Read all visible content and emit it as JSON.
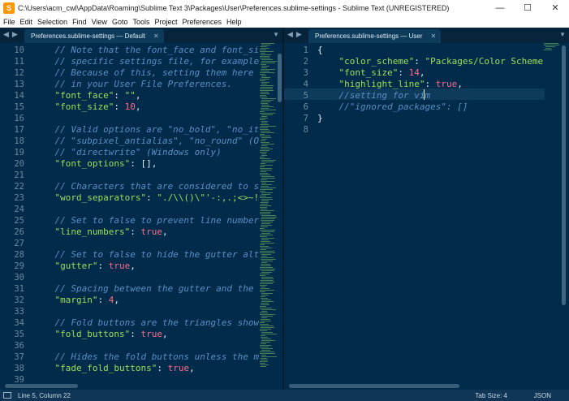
{
  "window": {
    "title": "C:\\Users\\acm_cwl\\AppData\\Roaming\\Sublime Text 3\\Packages\\User\\Preferences.sublime-settings - Sublime Text (UNREGISTERED)",
    "minimize": "—",
    "maximize": "☐",
    "close": "✕"
  },
  "menu": [
    "File",
    "Edit",
    "Selection",
    "Find",
    "View",
    "Goto",
    "Tools",
    "Project",
    "Preferences",
    "Help"
  ],
  "left_pane": {
    "tab_label": "Preferences.sublime-settings — Default",
    "line_numbers": [
      "10",
      "11",
      "12",
      "13",
      "14",
      "15",
      "16",
      "17",
      "18",
      "19",
      "20",
      "21",
      "22",
      "23",
      "24",
      "25",
      "26",
      "27",
      "28",
      "29",
      "30",
      "31",
      "32",
      "33",
      "34",
      "35",
      "36",
      "37",
      "38",
      "39"
    ],
    "lines": [
      [
        {
          "t": "    // Note that the font_face and font_si",
          "c": "comment"
        }
      ],
      [
        {
          "t": "    // specific settings file, for example,",
          "c": "comment"
        }
      ],
      [
        {
          "t": "    // Because of this, setting them here",
          "c": "comment"
        }
      ],
      [
        {
          "t": "    // in your User File Preferences.",
          "c": "comment"
        }
      ],
      [
        {
          "t": "    ",
          "c": "punc"
        },
        {
          "t": "\"font_face\"",
          "c": "key"
        },
        {
          "t": ": ",
          "c": "punc"
        },
        {
          "t": "\"\"",
          "c": "str"
        },
        {
          "t": ",",
          "c": "punc"
        }
      ],
      [
        {
          "t": "    ",
          "c": "punc"
        },
        {
          "t": "\"font_size\"",
          "c": "key"
        },
        {
          "t": ": ",
          "c": "punc"
        },
        {
          "t": "10",
          "c": "num"
        },
        {
          "t": ",",
          "c": "punc"
        }
      ],
      [
        {
          "t": "",
          "c": "punc"
        }
      ],
      [
        {
          "t": "    // Valid options are \"no_bold\", \"no_ita",
          "c": "comment"
        }
      ],
      [
        {
          "t": "    // \"subpixel_antialias\", \"no_round\" (OS",
          "c": "comment"
        }
      ],
      [
        {
          "t": "    // \"directwrite\" (Windows only)",
          "c": "comment"
        }
      ],
      [
        {
          "t": "    ",
          "c": "punc"
        },
        {
          "t": "\"font_options\"",
          "c": "key"
        },
        {
          "t": ": [],",
          "c": "punc"
        }
      ],
      [
        {
          "t": "",
          "c": "punc"
        }
      ],
      [
        {
          "t": "    // Characters that are considered to se",
          "c": "comment"
        }
      ],
      [
        {
          "t": "    ",
          "c": "punc"
        },
        {
          "t": "\"word_separators\"",
          "c": "key"
        },
        {
          "t": ": ",
          "c": "punc"
        },
        {
          "t": "\"./\\\\()\\\"'-:,.;<>~!@",
          "c": "str"
        }
      ],
      [
        {
          "t": "",
          "c": "punc"
        }
      ],
      [
        {
          "t": "    // Set to false to prevent line numbers",
          "c": "comment"
        }
      ],
      [
        {
          "t": "    ",
          "c": "punc"
        },
        {
          "t": "\"line_numbers\"",
          "c": "key"
        },
        {
          "t": ": ",
          "c": "punc"
        },
        {
          "t": "true",
          "c": "kw"
        },
        {
          "t": ",",
          "c": "punc"
        }
      ],
      [
        {
          "t": "",
          "c": "punc"
        }
      ],
      [
        {
          "t": "    // Set to false to hide the gutter alto",
          "c": "comment"
        }
      ],
      [
        {
          "t": "    ",
          "c": "punc"
        },
        {
          "t": "\"gutter\"",
          "c": "key"
        },
        {
          "t": ": ",
          "c": "punc"
        },
        {
          "t": "true",
          "c": "kw"
        },
        {
          "t": ",",
          "c": "punc"
        }
      ],
      [
        {
          "t": "",
          "c": "punc"
        }
      ],
      [
        {
          "t": "    // Spacing between the gutter and the t",
          "c": "comment"
        }
      ],
      [
        {
          "t": "    ",
          "c": "punc"
        },
        {
          "t": "\"margin\"",
          "c": "key"
        },
        {
          "t": ": ",
          "c": "punc"
        },
        {
          "t": "4",
          "c": "num"
        },
        {
          "t": ",",
          "c": "punc"
        }
      ],
      [
        {
          "t": "",
          "c": "punc"
        }
      ],
      [
        {
          "t": "    // Fold buttons are the triangles shown",
          "c": "comment"
        }
      ],
      [
        {
          "t": "    ",
          "c": "punc"
        },
        {
          "t": "\"fold_buttons\"",
          "c": "key"
        },
        {
          "t": ": ",
          "c": "punc"
        },
        {
          "t": "true",
          "c": "kw"
        },
        {
          "t": ",",
          "c": "punc"
        }
      ],
      [
        {
          "t": "",
          "c": "punc"
        }
      ],
      [
        {
          "t": "    // Hides the fold buttons unless the mo",
          "c": "comment"
        }
      ],
      [
        {
          "t": "    ",
          "c": "punc"
        },
        {
          "t": "\"fade_fold_buttons\"",
          "c": "key"
        },
        {
          "t": ": ",
          "c": "punc"
        },
        {
          "t": "true",
          "c": "kw"
        },
        {
          "t": ",",
          "c": "punc"
        }
      ],
      [
        {
          "t": "",
          "c": "punc"
        }
      ]
    ]
  },
  "right_pane": {
    "tab_label": "Preferences.sublime-settings — User",
    "line_numbers": [
      "1",
      "2",
      "3",
      "4",
      "5",
      "6",
      "7",
      "8"
    ],
    "current_line": 5,
    "lines": [
      [
        {
          "t": "{",
          "c": "punc"
        }
      ],
      [
        {
          "t": "    ",
          "c": "punc"
        },
        {
          "t": "\"color_scheme\"",
          "c": "key"
        },
        {
          "t": ": ",
          "c": "punc"
        },
        {
          "t": "\"Packages/Color Scheme -",
          "c": "str"
        }
      ],
      [
        {
          "t": "    ",
          "c": "punc"
        },
        {
          "t": "\"font_size\"",
          "c": "key"
        },
        {
          "t": ": ",
          "c": "punc"
        },
        {
          "t": "14",
          "c": "num"
        },
        {
          "t": ",",
          "c": "punc"
        }
      ],
      [
        {
          "t": "    ",
          "c": "punc"
        },
        {
          "t": "\"highlight_line\"",
          "c": "key"
        },
        {
          "t": ": ",
          "c": "punc"
        },
        {
          "t": "true",
          "c": "kw"
        },
        {
          "t": ",",
          "c": "punc"
        }
      ],
      [
        {
          "t": "    //setting for vim",
          "c": "comment"
        }
      ],
      [
        {
          "t": "    //\"ignored_packages\": []",
          "c": "comment"
        }
      ],
      [
        {
          "t": "}",
          "c": "punc"
        }
      ],
      [
        {
          "t": "",
          "c": "punc"
        }
      ]
    ]
  },
  "status": {
    "position": "Line 5, Column 22",
    "tab_size": "Tab Size: 4",
    "syntax": "JSON"
  },
  "colors": {
    "background": "#002b4a",
    "comment": "#5d8fc6",
    "key": "#9ee05a",
    "number": "#ff6b8a"
  }
}
